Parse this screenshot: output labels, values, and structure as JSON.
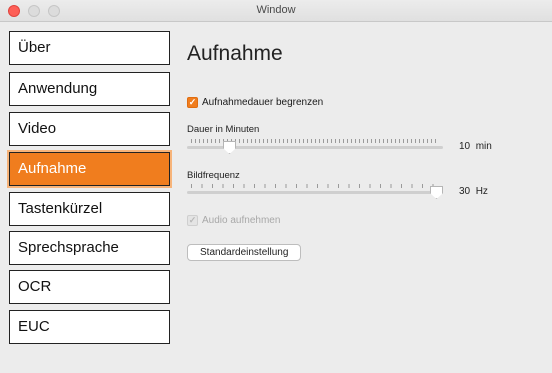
{
  "window": {
    "title": "Window"
  },
  "sidebar": {
    "items": [
      {
        "label": "Über"
      },
      {
        "label": "Anwendung"
      },
      {
        "label": "Video"
      },
      {
        "label": "Aufnahme",
        "active": true
      },
      {
        "label": "Tastenkürzel"
      },
      {
        "label": "Sprechsprache"
      },
      {
        "label": "OCR"
      },
      {
        "label": "EUC"
      }
    ]
  },
  "main": {
    "title": "Aufnahme",
    "limit_duration": {
      "label": "Aufnahmedauer begrenzen",
      "checked": true
    },
    "duration": {
      "label": "Dauer in Minuten",
      "value": "10",
      "unit": "min",
      "fraction": 0.15
    },
    "framerate": {
      "label": "Bildfrequenz",
      "value": "30",
      "unit": "Hz",
      "fraction": 1.0
    },
    "audio": {
      "label": "Audio aufnehmen",
      "checked": true,
      "disabled": true
    },
    "reset_button": "Standardeinstellung"
  },
  "colors": {
    "accent": "#f07d1e",
    "close": "#fe5f57"
  },
  "icons": {
    "checkmark": "✓"
  }
}
